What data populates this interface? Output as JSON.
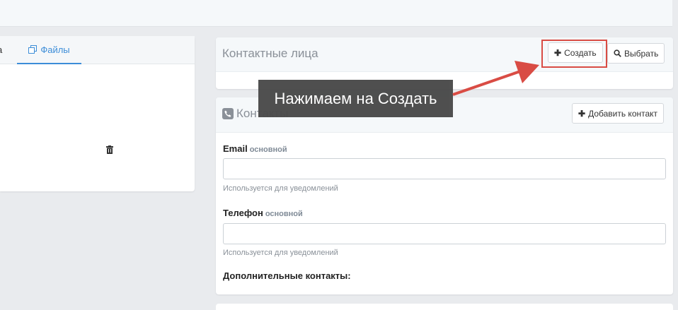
{
  "left": {
    "tab_partial": "а",
    "tab_files": "Файлы"
  },
  "contacts_persons": {
    "title": "Контактные лица",
    "create_label": "Создать",
    "select_label": "Выбрать"
  },
  "contacts": {
    "title": "Контакты",
    "add_label": "Добавить контакт",
    "email_label": "Email",
    "email_sub": "основной",
    "email_value": "",
    "email_hint": "Используется для уведомлений",
    "phone_label": "Телефон",
    "phone_sub": "основной",
    "phone_value": "",
    "phone_hint": "Используется для уведомлений",
    "additional_label": "Дополнительные контакты:"
  },
  "annotation": {
    "text": "Нажимаем на Создать",
    "color": "#d94c44"
  },
  "colors": {
    "accent": "#3c8dd8",
    "highlight": "#d94c44"
  }
}
